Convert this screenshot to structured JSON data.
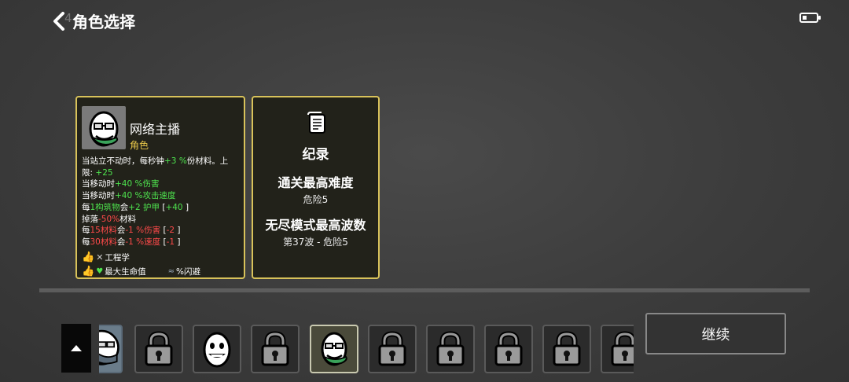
{
  "header": {
    "back_number": "4",
    "title": "角色选择"
  },
  "character": {
    "name": "网络主播",
    "type": "角色",
    "stat_lines": [
      [
        {
          "t": "当站立不动时，每秒钟",
          "c": "b"
        },
        {
          "t": "+3 %",
          "c": "g"
        },
        {
          "t": "份材料。上",
          "c": "b"
        }
      ],
      [
        {
          "t": "限: ",
          "c": "b"
        },
        {
          "t": "+25",
          "c": "g"
        }
      ],
      [
        {
          "t": "当移动时",
          "c": "b"
        },
        {
          "t": "+40 %伤害",
          "c": "g"
        }
      ],
      [
        {
          "t": "当移动时",
          "c": "b"
        },
        {
          "t": "+40 %攻击速度",
          "c": "g"
        }
      ],
      [
        {
          "t": "每",
          "c": "b"
        },
        {
          "t": "1构筑物",
          "c": "g"
        },
        {
          "t": "会",
          "c": "b"
        },
        {
          "t": "+2 护甲",
          "c": "g"
        },
        {
          "t": " [",
          "c": "b"
        },
        {
          "t": "+40",
          "c": "g"
        },
        {
          "t": " ]",
          "c": "b"
        }
      ],
      [
        {
          "t": "掉落",
          "c": "b"
        },
        {
          "t": "-50%",
          "c": "r"
        },
        {
          "t": "材料",
          "c": "b"
        }
      ],
      [
        {
          "t": "每",
          "c": "b"
        },
        {
          "t": "15材料",
          "c": "r"
        },
        {
          "t": "会",
          "c": "b"
        },
        {
          "t": "-1 %伤害",
          "c": "r"
        },
        {
          "t": " [",
          "c": "b"
        },
        {
          "t": "-2",
          "c": "r"
        },
        {
          "t": " ]",
          "c": "b"
        }
      ],
      [
        {
          "t": "每",
          "c": "b"
        },
        {
          "t": "30材料",
          "c": "r"
        },
        {
          "t": "会",
          "c": "b"
        },
        {
          "t": "-1 %速度",
          "c": "r"
        },
        {
          "t": " [",
          "c": "b"
        },
        {
          "t": "-1",
          "c": "r"
        },
        {
          "t": " ]",
          "c": "b"
        }
      ]
    ],
    "tag_engineering": "工程学",
    "tag_max_hp": "最大生命值",
    "tag_dodge": "%闪避"
  },
  "records": {
    "title": "纪录",
    "max_difficulty_label": "通关最高难度",
    "max_difficulty_value": "危险5",
    "endless_label": "无尽模式最高波数",
    "endless_value": "第37波 - 危险5"
  },
  "slots": [
    {
      "kind": "partial"
    },
    {
      "kind": "locked"
    },
    {
      "kind": "egg"
    },
    {
      "kind": "locked"
    },
    {
      "kind": "streamer",
      "selected": true
    },
    {
      "kind": "locked"
    },
    {
      "kind": "locked"
    },
    {
      "kind": "locked"
    },
    {
      "kind": "locked"
    },
    {
      "kind": "locked"
    }
  ],
  "buttons": {
    "continue": "继续"
  },
  "colors": {
    "panel_border": "#d8c25a",
    "positive": "#4ee44e",
    "negative": "#ff4a4a",
    "type_yellow": "#e9c84a"
  }
}
